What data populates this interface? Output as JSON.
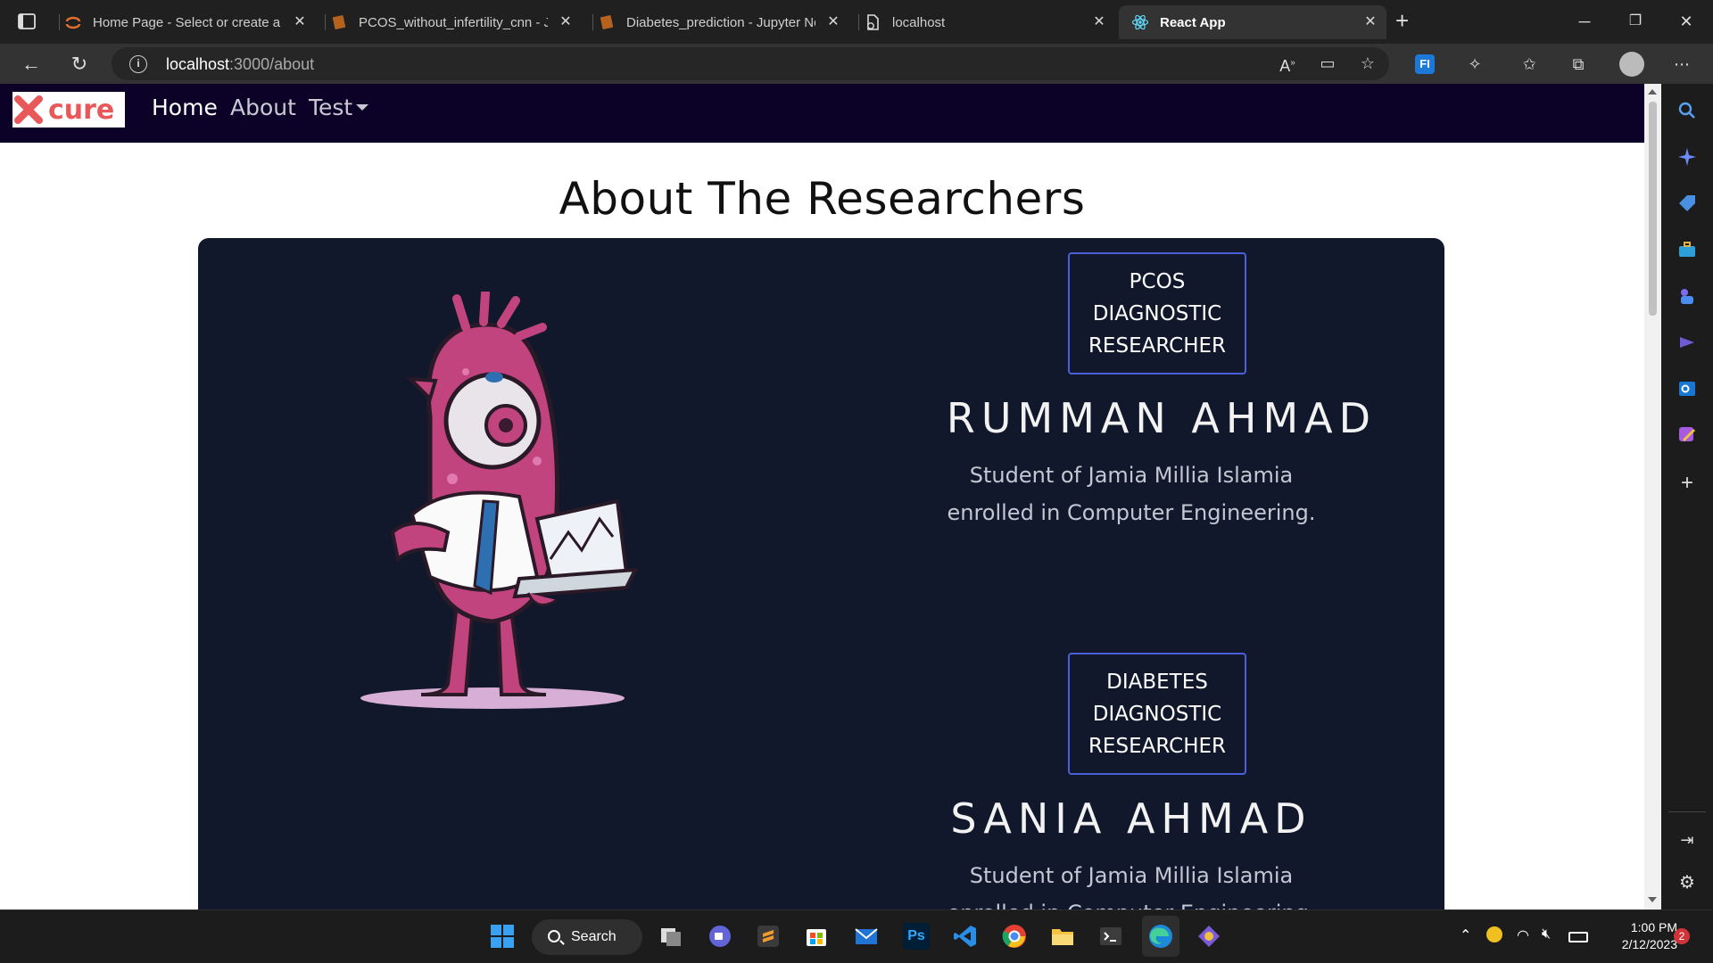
{
  "browser": {
    "tabs": [
      {
        "title": "Home Page - Select or create a n",
        "icon": "jupyter-icon"
      },
      {
        "title": "PCOS_without_infertility_cnn - Ju",
        "icon": "notebook-icon"
      },
      {
        "title": "Diabetes_prediction - Jupyter Nc",
        "icon": "notebook-icon"
      },
      {
        "title": "localhost",
        "icon": "page-icon"
      },
      {
        "title": "React App",
        "icon": "react-icon"
      }
    ],
    "address": {
      "host": "localhost",
      "path": ":3000/about"
    }
  },
  "navbar": {
    "logo_text": "cure",
    "links": {
      "home": "Home",
      "about": "About",
      "test": "Test"
    }
  },
  "page": {
    "heading": "About The Researchers",
    "researchers": [
      {
        "role_lines": [
          "PCOS",
          "DIAGNOSTIC",
          "RESEARCHER"
        ],
        "name": "RUMMAN AHMAD",
        "desc_lines": [
          "Student of Jamia Millia Islamia",
          "enrolled in Computer Engineering."
        ]
      },
      {
        "role_lines": [
          "DIABETES",
          "DIAGNOSTIC",
          "RESEARCHER"
        ],
        "name": "SANIA AHMAD",
        "desc_lines": [
          "Student of Jamia Millia Islamia",
          "enrolled in Computer Engineering."
        ]
      }
    ]
  },
  "taskbar": {
    "search_label": "Search",
    "time": "1:00 PM",
    "date": "2/12/2023",
    "notification_count": "2",
    "apps_label": "Ps"
  },
  "colors": {
    "navbar_bg": "#0c0228",
    "card_bg": "#11182b",
    "badge_border": "#4a5fd8",
    "logo_red": "#e8585a"
  }
}
